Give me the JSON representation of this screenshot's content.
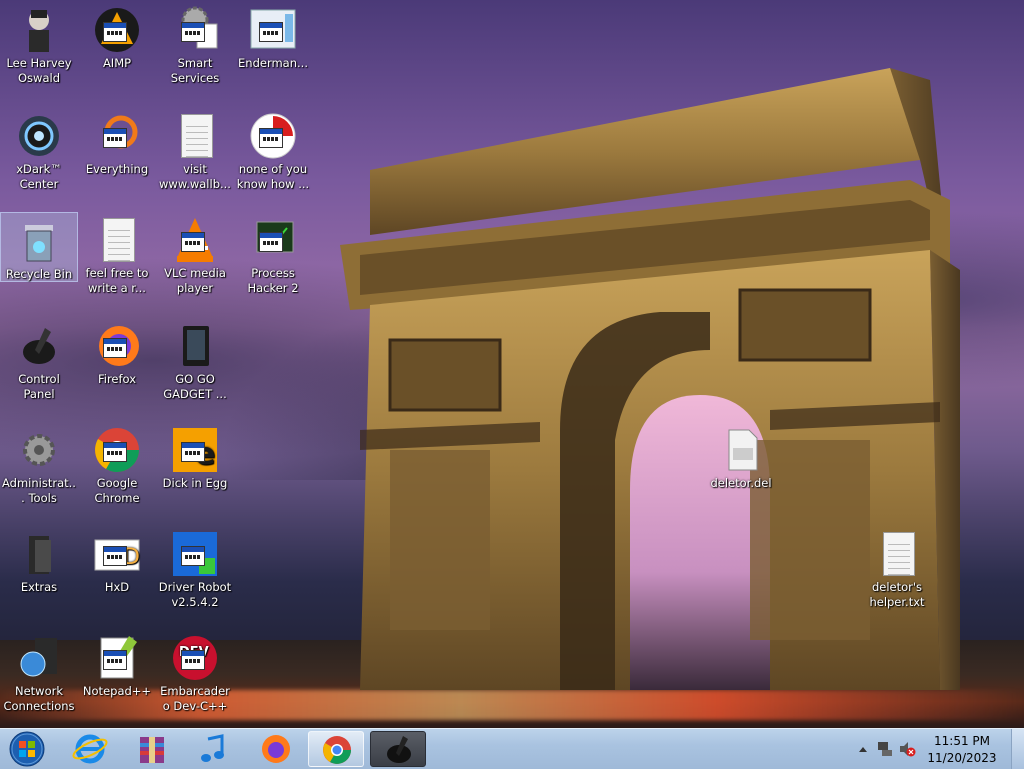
{
  "desktop": {
    "icons": [
      {
        "label": "Lee Harvey Oswald"
      },
      {
        "label": "AIMP"
      },
      {
        "label": "Smart Services"
      },
      {
        "label": "Enderman..."
      },
      {
        "label": "xDark™ Center"
      },
      {
        "label": "Everything"
      },
      {
        "label": "visit www.wallb..."
      },
      {
        "label": "none of you know how ..."
      },
      {
        "label": "Recycle Bin"
      },
      {
        "label": "feel free to write a r..."
      },
      {
        "label": "VLC media player"
      },
      {
        "label": "Process Hacker 2"
      },
      {
        "label": "Control Panel"
      },
      {
        "label": "Firefox"
      },
      {
        "label": "GO GO GADGET ..."
      },
      {
        "label": "Administrat... Tools"
      },
      {
        "label": "Google Chrome"
      },
      {
        "label": "Dick in Egg"
      },
      {
        "label": "Extras"
      },
      {
        "label": "HxD"
      },
      {
        "label": "Driver Robot v2.5.4.2"
      },
      {
        "label": "Network Connections"
      },
      {
        "label": "Notepad++"
      },
      {
        "label": "Embarcadero Dev-C++"
      },
      {
        "label": "deletor.del"
      },
      {
        "label": "deletor's helper.txt"
      }
    ]
  },
  "taskbar": {
    "clock_time": "11:51 PM",
    "clock_date": "11/20/2023",
    "pinned": [
      "internet-explorer",
      "winrar",
      "media-player",
      "firefox",
      "chrome",
      "control-panel"
    ]
  },
  "colors": {
    "taskbar": "#a9c3e0",
    "selection": "#b4c8e6"
  }
}
